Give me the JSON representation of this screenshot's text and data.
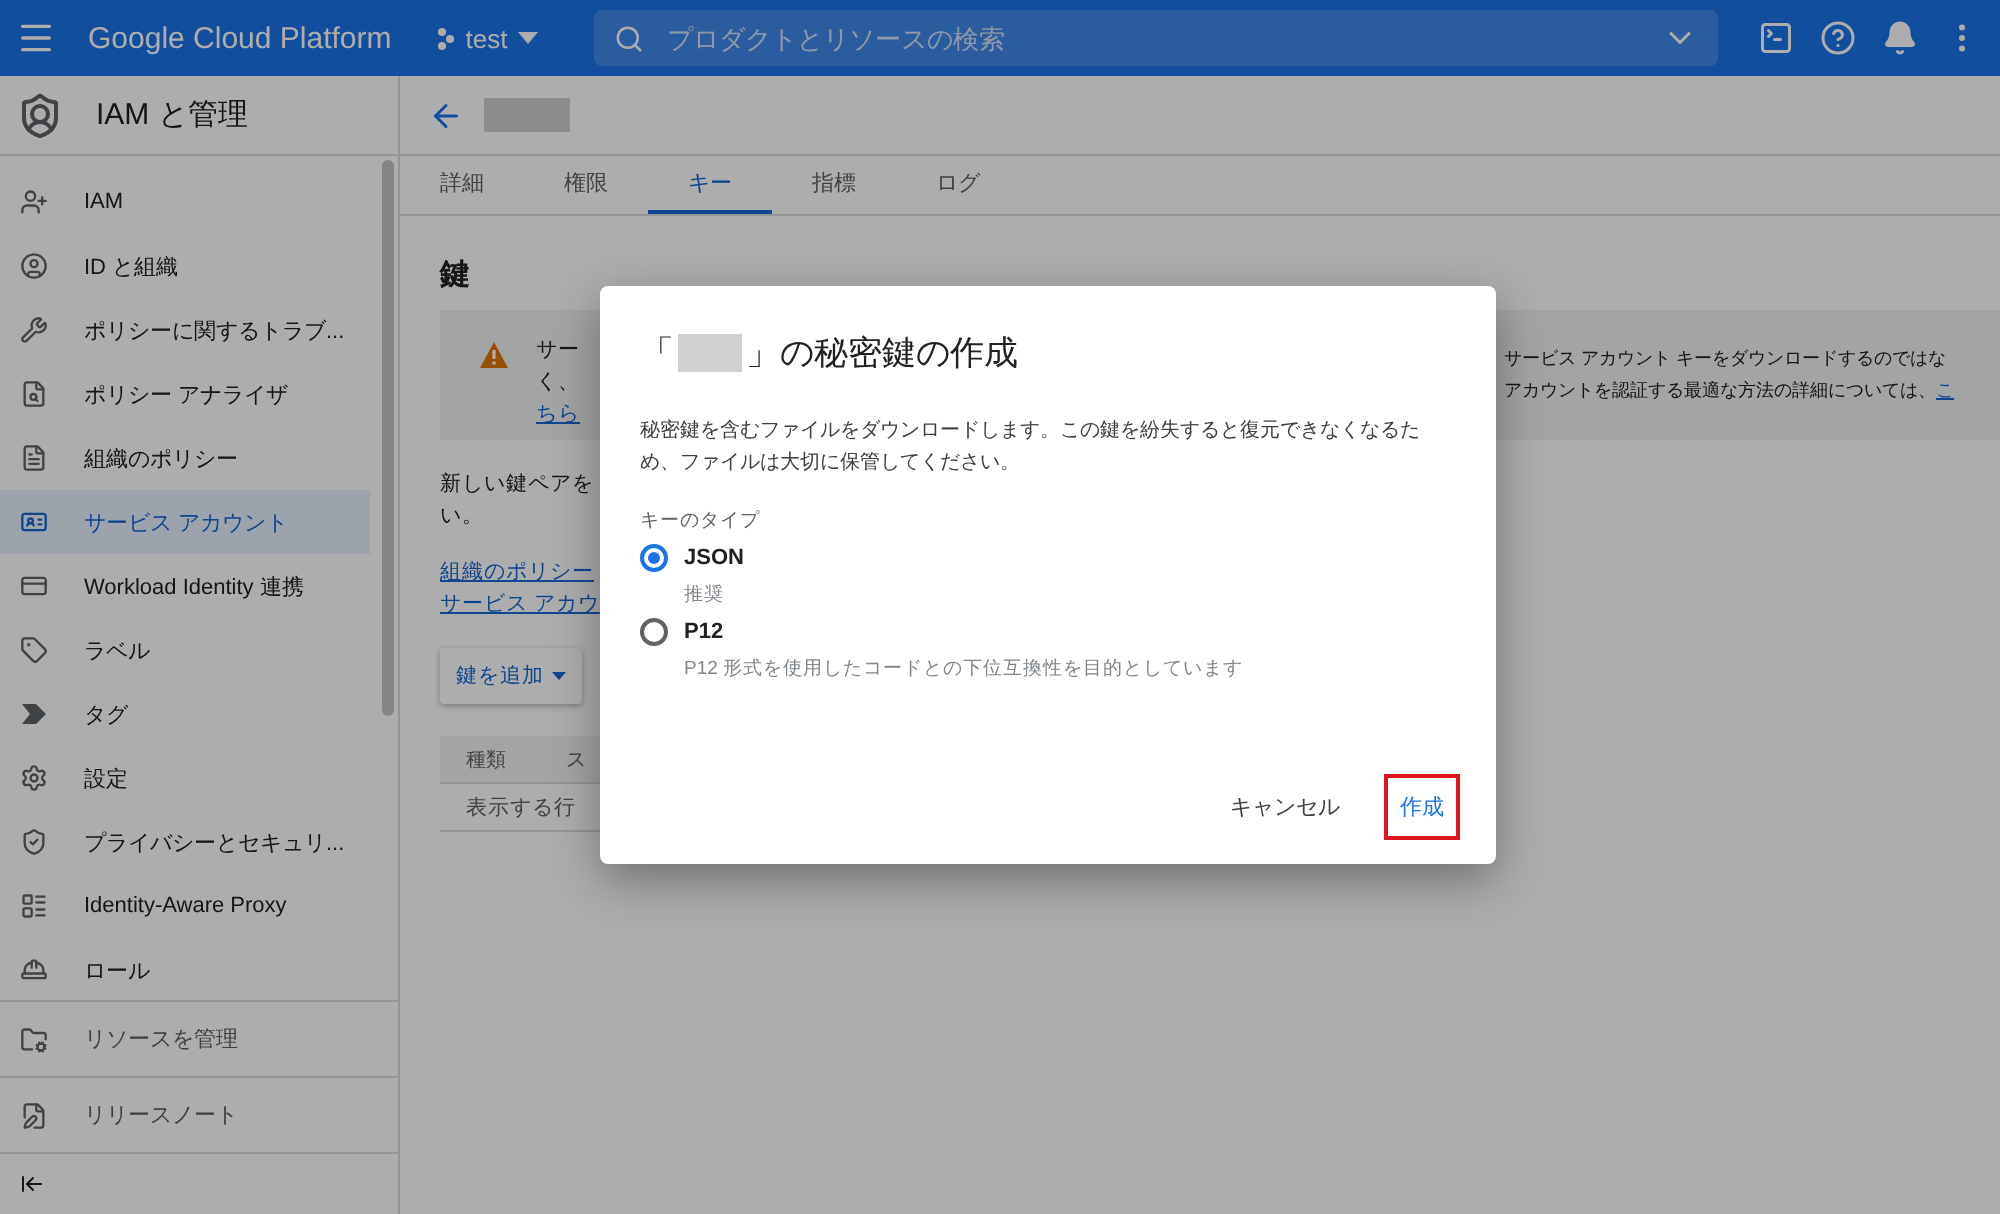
{
  "topbar": {
    "product": "Google Cloud Platform",
    "project": "test",
    "search": {
      "placeholder": "プロダクトとリソースの検索"
    }
  },
  "sidebar": {
    "title": "IAM と管理",
    "items": [
      {
        "label": "IAM",
        "selected": false
      },
      {
        "label": "ID と組織",
        "selected": false
      },
      {
        "label": "ポリシーに関するトラブ...",
        "selected": false
      },
      {
        "label": "ポリシー アナライザ",
        "selected": false
      },
      {
        "label": "組織のポリシー",
        "selected": false
      },
      {
        "label": "サービス アカウント",
        "selected": true
      },
      {
        "label": "Workload Identity 連携",
        "selected": false
      },
      {
        "label": "ラベル",
        "selected": false
      },
      {
        "label": "タグ",
        "selected": false
      },
      {
        "label": "設定",
        "selected": false
      },
      {
        "label": "プライバシーとセキュリ...",
        "selected": false
      },
      {
        "label": "Identity-Aware Proxy",
        "selected": false
      },
      {
        "label": "ロール",
        "selected": false
      }
    ],
    "footer": [
      {
        "label": "リソースを管理"
      },
      {
        "label": "リリースノート"
      }
    ]
  },
  "main": {
    "tabs": [
      {
        "label": "詳細",
        "selected": false
      },
      {
        "label": "権限",
        "selected": false
      },
      {
        "label": "キー",
        "selected": true
      },
      {
        "label": "指標",
        "selected": false
      },
      {
        "label": "ログ",
        "selected": false
      }
    ],
    "section_title": "鍵",
    "warning": {
      "left_lines": [
        "サー",
        "く、"
      ],
      "left_link": "ちら",
      "right_lines": [
        "サービス アカウント キーをダウンロードするのではな",
        "アカウントを認証する最適な方法の詳細については、"
      ],
      "right_link": "こ"
    },
    "intro_lines": [
      "新しい鍵ペアを",
      "い。"
    ],
    "links": [
      "組織のポリシー",
      "サービス アカウ"
    ],
    "add_button": "鍵を追加",
    "table": {
      "columns": [
        "種類",
        "ス"
      ],
      "empty_text": "表示する行"
    }
  },
  "dialog": {
    "title_prefix": "「",
    "title_suffix": "」の秘密鍵の作成",
    "description": "秘密鍵を含むファイルをダウンロードします。この鍵を紛失すると復元できなくなるため、ファイルは大切に保管してください。",
    "key_type_label": "キーのタイプ",
    "options": [
      {
        "label": "JSON",
        "hint": "推奨",
        "selected": true
      },
      {
        "label": "P12",
        "hint": "P12 形式を使用したコードとの下位互換性を目的としています",
        "selected": false
      }
    ],
    "buttons": [
      {
        "label": "キャンセル",
        "kind": "text",
        "highlighted": false
      },
      {
        "label": "作成",
        "kind": "primary",
        "highlighted": true
      }
    ]
  }
}
